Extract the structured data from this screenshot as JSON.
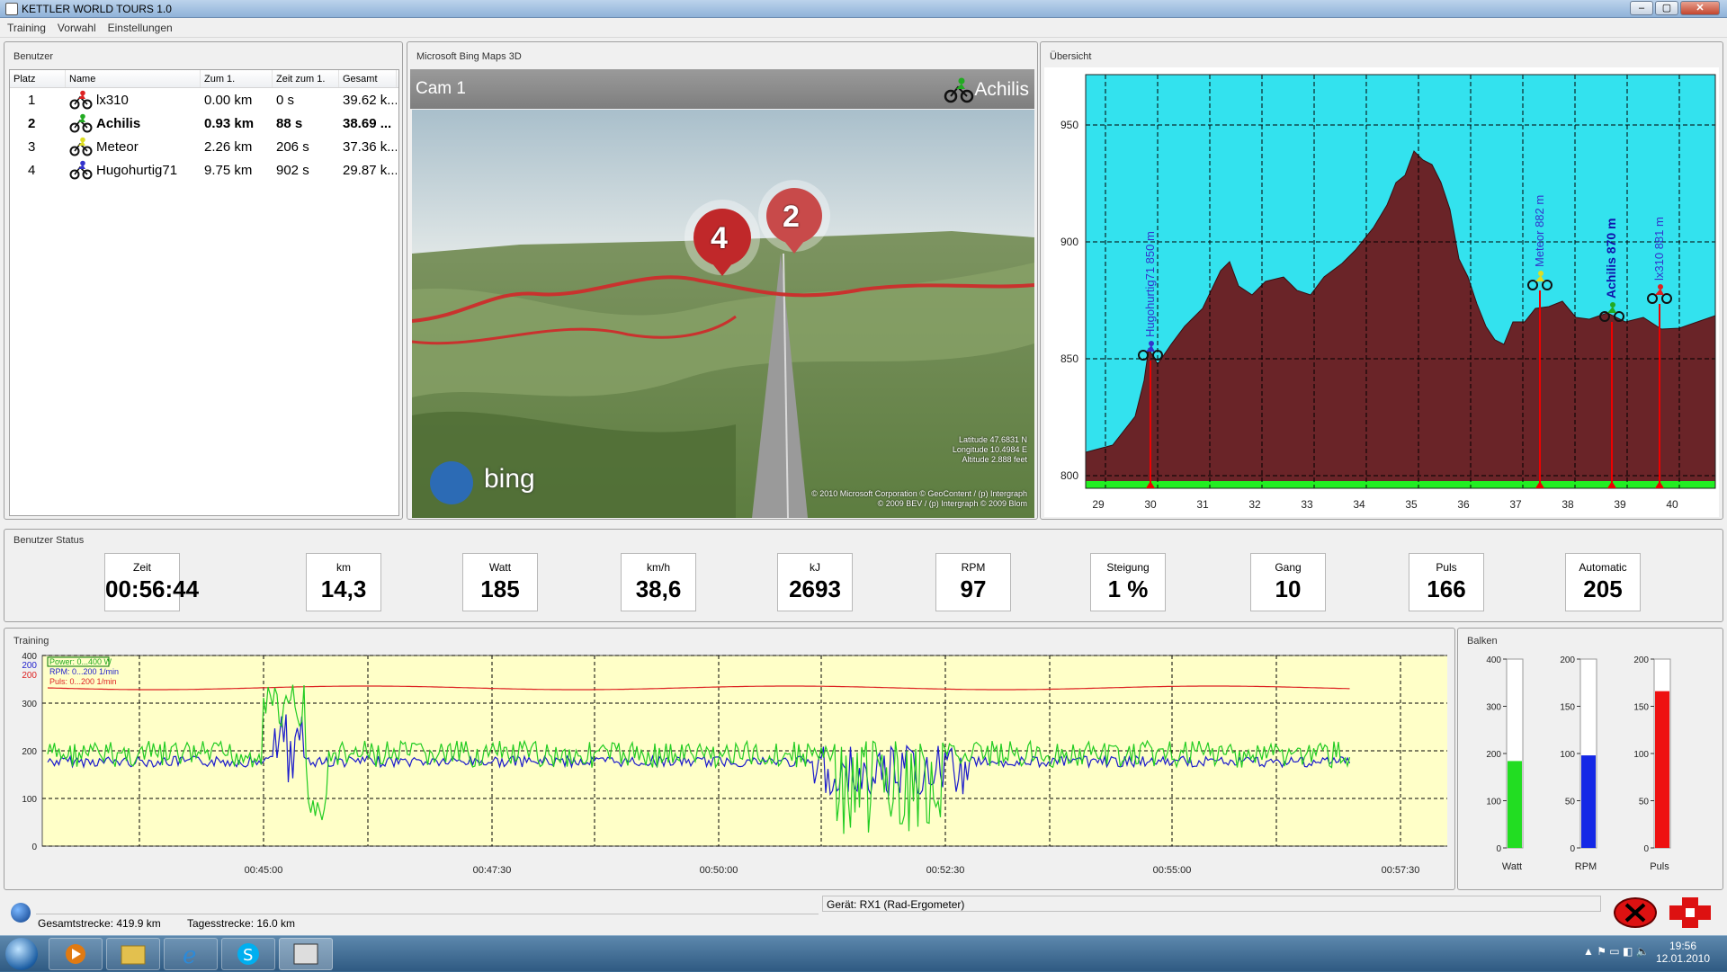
{
  "window": {
    "title": "KETTLER WORLD TOURS 1.0"
  },
  "menu": [
    "Training",
    "Vorwahl",
    "Einstellungen"
  ],
  "users_panel": {
    "title": "Benutzer",
    "headers": [
      "Platz",
      "Name",
      "Zum 1.",
      "Zeit zum 1.",
      "Gesamt"
    ],
    "rows": [
      {
        "rank": "1",
        "name": "lx310",
        "dist": "0.00 km",
        "time": "0 s",
        "total": "39.62 k...",
        "bold": false,
        "color": "#d22"
      },
      {
        "rank": "2",
        "name": "Achilis",
        "dist": "0.93 km",
        "time": "88 s",
        "total": "38.69 ...",
        "bold": true,
        "color": "#2a2"
      },
      {
        "rank": "3",
        "name": "Meteor",
        "dist": "2.26 km",
        "time": "206 s",
        "total": "37.36 k...",
        "bold": false,
        "color": "#dd2"
      },
      {
        "rank": "4",
        "name": "Hugohurtig71",
        "dist": "9.75 km",
        "time": "902 s",
        "total": "29.87 k...",
        "bold": false,
        "color": "#33c"
      }
    ]
  },
  "map_panel": {
    "title": "Microsoft Bing Maps 3D",
    "cam": "Cam 1",
    "user": "Achilis",
    "markers": [
      "4",
      "2"
    ],
    "brand": "bing",
    "coords": [
      "Latitude 47.6831 N",
      "Longitude 10.4984 E",
      "Altitude 2.888 feet"
    ],
    "copyright": [
      "© 2010 Microsoft Corporation  © GeoContent / (p) Intergraph",
      "© 2009 BEV / (p) Intergraph  © 2009 Blom"
    ]
  },
  "overview": {
    "title": "Übersicht",
    "y_ticks": [
      "950",
      "900",
      "850",
      "800"
    ],
    "x_ticks": [
      "29",
      "30",
      "31",
      "32",
      "33",
      "34",
      "35",
      "36",
      "37",
      "38",
      "39",
      "40"
    ],
    "riders": [
      {
        "label": "Hugohurtig71 850 m",
        "color": "#33c",
        "bold": false
      },
      {
        "label": "Meteor 882 m",
        "color": "#33c",
        "bold": false
      },
      {
        "label": "Achilis 870 m",
        "color": "#11a",
        "bold": true
      },
      {
        "label": "lx310 881 m",
        "color": "#33c",
        "bold": false
      }
    ]
  },
  "status_panel": {
    "title": "Benutzer Status",
    "items": [
      {
        "label": "Zeit",
        "value": "00:56:44"
      },
      {
        "label": "km",
        "value": "14,3"
      },
      {
        "label": "Watt",
        "value": "185"
      },
      {
        "label": "km/h",
        "value": "38,6"
      },
      {
        "label": "kJ",
        "value": "2693"
      },
      {
        "label": "RPM",
        "value": "97"
      },
      {
        "label": "Steigung",
        "value": "1 %"
      },
      {
        "label": "Gang",
        "value": "10"
      },
      {
        "label": "Puls",
        "value": "166"
      },
      {
        "label": "Automatic",
        "value": "205"
      }
    ]
  },
  "training": {
    "title": "Training",
    "legend": [
      "Power: 0...400 W",
      "RPM: 0...200 1/min",
      "Puls: 0...200 1/min"
    ],
    "y_left": [
      "400",
      "300",
      "200",
      "100",
      "0"
    ],
    "y_blue": "200",
    "y_red": "200",
    "x_ticks": [
      "00:45:00",
      "00:47:30",
      "00:50:00",
      "00:52:30",
      "00:55:00",
      "00:57:30"
    ]
  },
  "bars": {
    "title": "Balken",
    "items": [
      {
        "label": "Watt",
        "ticks": [
          "400",
          "300",
          "200",
          "100",
          "0"
        ],
        "fraction": 0.46,
        "color": "#22dd22"
      },
      {
        "label": "RPM",
        "ticks": [
          "200",
          "150",
          "100",
          "50",
          "0"
        ],
        "fraction": 0.49,
        "color": "#1428e6"
      },
      {
        "label": "Puls",
        "ticks": [
          "200",
          "150",
          "100",
          "50",
          "0"
        ],
        "fraction": 0.83,
        "color": "#ee1111"
      }
    ]
  },
  "footer": {
    "gesamt": "Gesamtstrecke: 419.9 km",
    "tages": "Tagesstrecke: 16.0 km",
    "geraet": "Gerät: RX1 (Rad-Ergometer)"
  },
  "taskbar": {
    "time": "19:56",
    "date": "12.01.2010"
  }
}
